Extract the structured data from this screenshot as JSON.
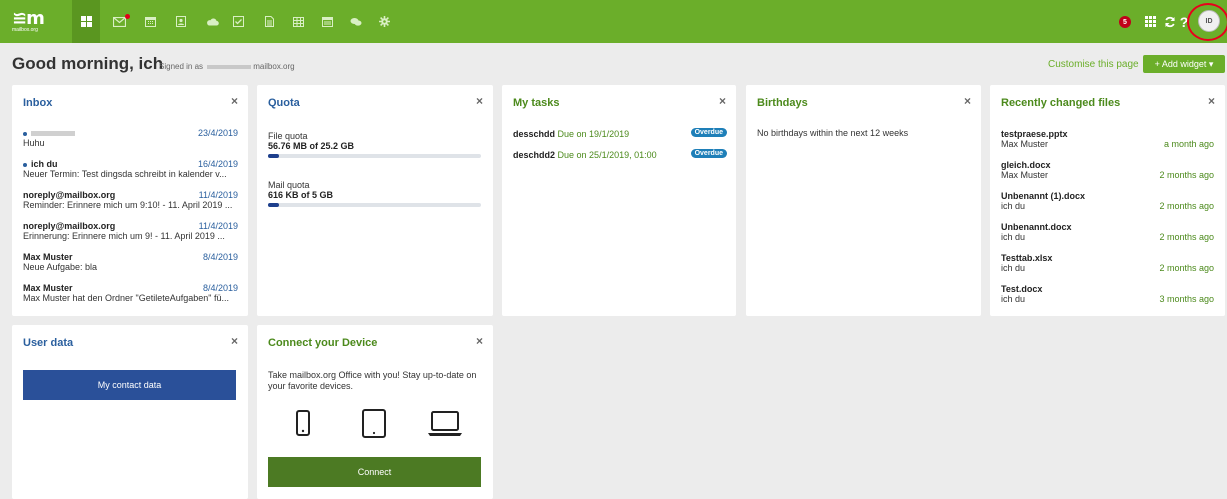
{
  "brand": {
    "logo_text": "≌m",
    "logo_sub": "mailbox.org"
  },
  "topbar": {
    "nav_icons": [
      "dashboard-icon",
      "mail-icon",
      "calendar-icon",
      "contacts-icon",
      "cloud-icon",
      "tasks-icon",
      "documents-icon",
      "spreadsheet-icon",
      "presentation-icon",
      "chat-icon",
      "settings-icon"
    ],
    "notification_count": "5",
    "avatar_initials": "ID",
    "colors": {
      "bar": "#6bae2a",
      "active": "#5a9620",
      "badge": "#c1001a"
    }
  },
  "header": {
    "greeting": "Good morning, ich",
    "signed_in_prefix": "Signed in as",
    "signed_in_suffix": "mailbox.org",
    "customise": "Customise this page",
    "add_widget": "+ Add widget ▾"
  },
  "inbox": {
    "title": "Inbox",
    "close": "×",
    "items": [
      {
        "from": "",
        "date": "23/4/2019",
        "subject": "Huhu"
      },
      {
        "from": "ich du",
        "date": "16/4/2019",
        "subject": "Neuer Termin: Test dingsda schreibt in kalender v..."
      },
      {
        "from": "noreply@mailbox.org",
        "date": "11/4/2019",
        "subject": "Reminder: Erinnere mich um 9:10! - 11. April 2019 ..."
      },
      {
        "from": "noreply@mailbox.org",
        "date": "11/4/2019",
        "subject": "Erinnerung: Erinnere mich um 9! - 11. April 2019 ..."
      },
      {
        "from": "Max Muster",
        "date": "8/4/2019",
        "subject": "Neue Aufgabe: bla"
      },
      {
        "from": "Max Muster",
        "date": "8/4/2019",
        "subject": "Max Muster hat den Ordner \"GetileteAufgaben\" fü..."
      }
    ]
  },
  "quota": {
    "title": "Quota",
    "close": "×",
    "file": {
      "label": "File quota",
      "value": "56.76 MB of 25.2 GB",
      "fraction": 0.05
    },
    "mail": {
      "label": "Mail quota",
      "value": "616 KB of 5 GB",
      "fraction": 0.05
    }
  },
  "tasks": {
    "title": "My tasks",
    "close": "×",
    "items": [
      {
        "name": "desschdd",
        "due": "Due on 19/1/2019",
        "status": "Overdue"
      },
      {
        "name": "deschdd2",
        "due": "Due on 25/1/2019, 01:00",
        "status": "Overdue"
      }
    ]
  },
  "birthdays": {
    "title": "Birthdays",
    "close": "×",
    "text": "No birthdays within the next 12 weeks"
  },
  "files": {
    "title": "Recently changed files",
    "close": "×",
    "items": [
      {
        "name": "testpraese.pptx",
        "by": "Max Muster",
        "when": "a month ago"
      },
      {
        "name": "gleich.docx",
        "by": "Max Muster",
        "when": "2 months ago"
      },
      {
        "name": "Unbenannt (1).docx",
        "by": "ich du",
        "when": "2 months ago"
      },
      {
        "name": "Unbenannt.docx",
        "by": "ich du",
        "when": "2 months ago"
      },
      {
        "name": "Testtab.xlsx",
        "by": "ich du",
        "when": "2 months ago"
      },
      {
        "name": "Test.docx",
        "by": "ich du",
        "when": "3 months ago"
      }
    ]
  },
  "userdata": {
    "title": "User data",
    "close": "×",
    "button": "My contact data"
  },
  "device": {
    "title": "Connect your Device",
    "close": "×",
    "text": "Take mailbox.org Office with you! Stay up-to-date on your favorite devices.",
    "icons": [
      "phone-icon",
      "tablet-icon",
      "laptop-icon"
    ],
    "button": "Connect"
  }
}
